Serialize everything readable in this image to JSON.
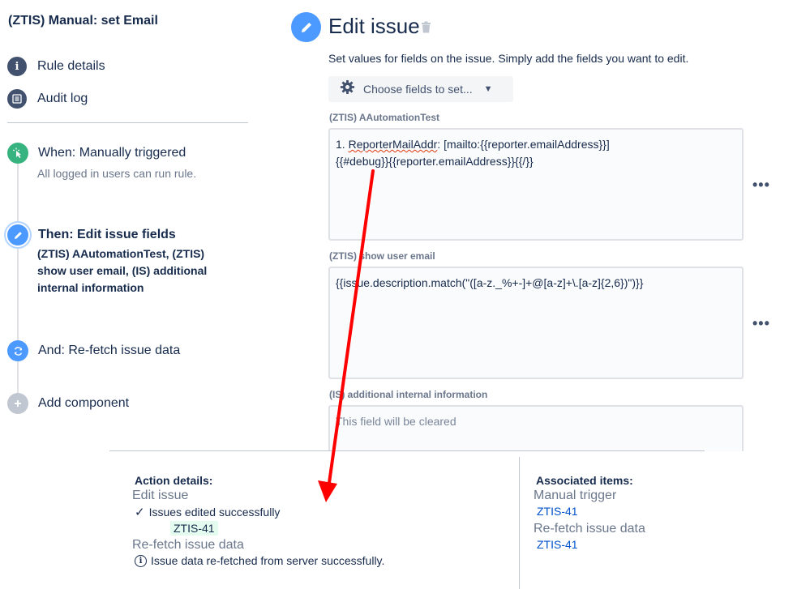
{
  "rule": {
    "title": "(ZTIS) Manual: set Email"
  },
  "nav": {
    "rule_details": "Rule details",
    "audit_log": "Audit log"
  },
  "steps": {
    "trigger": {
      "title": "When: Manually triggered",
      "subtitle": "All logged in users can run rule."
    },
    "edit": {
      "title": "Then: Edit issue fields",
      "desc": "(ZTIS) AAutomationTest, (ZTIS) show user email, (IS) additional internal information"
    },
    "refetch": {
      "title": "And: Re-fetch issue data"
    },
    "add": {
      "title": "Add component"
    }
  },
  "editor": {
    "title": "Edit issue",
    "description": "Set values for fields on the issue. Simply add the fields you want to edit.",
    "choose_label": "Choose fields to set...",
    "fields": [
      {
        "label": "(ZTIS) AAutomationTest",
        "prefix": "1. ",
        "squiggle": "ReporterMailAddr",
        "rest": ": [mailto:{{reporter.emailAddress}}]",
        "line2": "{{#debug}}{{reporter.emailAddress}}{{/}}"
      },
      {
        "label": "(ZTIS) show user email",
        "value": "{{issue.description.match(\"([a-z._%+-]+@[a-z]+\\.[a-z]{2,6})\")}}"
      },
      {
        "label": "(IS) additional internal information",
        "placeholder": "This field will be cleared"
      }
    ],
    "more": "•••"
  },
  "action_details": {
    "title": "Action details:",
    "edit_issue": "Edit issue",
    "edited_ok": "Issues edited successfully",
    "issue_key": "ZTIS-41",
    "refetch": "Re-fetch issue data",
    "refetch_ok": "Issue data re-fetched from server successfully."
  },
  "associated": {
    "title": "Associated items:",
    "manual_trigger": "Manual trigger",
    "key1": "ZTIS-41",
    "refetch": "Re-fetch issue data",
    "key2": "ZTIS-41"
  },
  "colors": {
    "primary_text": "#172b4d",
    "trigger_green": "#36b37e",
    "action_blue": "#4c9aff",
    "link_blue": "#0052cc",
    "annotation_red": "#ff0000"
  }
}
